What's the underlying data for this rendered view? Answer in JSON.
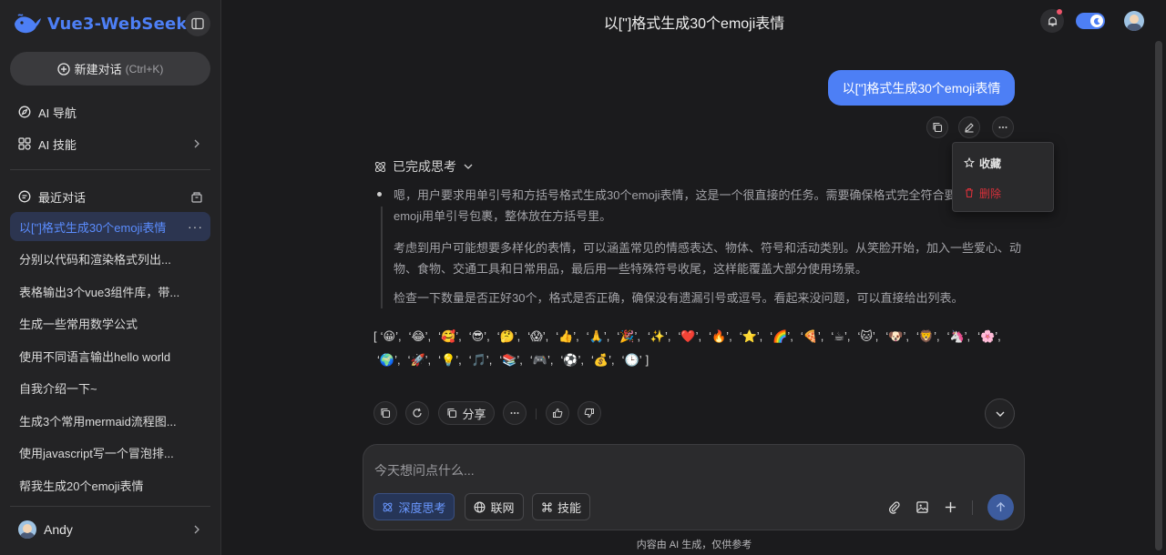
{
  "app": {
    "name": "Vue3-WebSeek",
    "accent": "#4d7ff5"
  },
  "sidebar": {
    "new_chat_label": "新建对话",
    "new_chat_shortcut": "(Ctrl+K)",
    "nav": [
      {
        "label": "AI 导航",
        "icon": "compass-icon"
      },
      {
        "label": "AI 技能",
        "icon": "grid-icon"
      }
    ],
    "recent_title": "最近对话",
    "conversations": [
      "以[\"]格式生成30个emoji表情",
      "分别以代码和渲染格式列出...",
      "表格输出3个vue3组件库，带...",
      "生成一些常用数学公式",
      "使用不同语言输出hello world",
      "自我介绍一下~",
      "生成3个常用mermaid流程图...",
      "使用javascript写一个冒泡排...",
      "帮我生成20个emoji表情"
    ],
    "active_more": "···",
    "user_name": "Andy"
  },
  "header": {
    "title": "以[\"]格式生成30个emoji表情"
  },
  "message": {
    "user_text": "以[\"]格式生成30个emoji表情",
    "menu": {
      "favorite": "收藏",
      "delete": "删除"
    },
    "thinking_label": "已完成思考",
    "thinking": [
      "嗯，用户要求用单引号和方括号格式生成30个emoji表情，这是一个很直接的任务。需要确保格式完全符合要求：每个emoji用单引号包裹，整体放在方括号里。",
      "考虑到用户可能想要多样化的表情，可以涵盖常见的情感表达、物体、符号和活动类别。从笑脸开始，加入一些爱心、动物、食物、交通工具和日常用品，最后用一些特殊符号收尾，这样能覆盖大部分使用场景。",
      "检查一下数量是否正好30个，格式是否正确，确保没有遗漏引号或逗号。看起来没问题，可以直接给出列表。"
    ],
    "open_bracket": "[",
    "close_bracket": "]",
    "emojis": [
      "😀",
      "😂",
      "🥰",
      "😎",
      "🤔",
      "😱",
      "👍",
      "🙏",
      "🎉",
      "✨",
      "❤️",
      "🔥",
      "⭐",
      "🌈",
      "🍕",
      "☕",
      "🐱",
      "🐶",
      "🦁",
      "🦄",
      "🌸",
      "🌍",
      "🚀",
      "💡",
      "🎵",
      "📚",
      "🎮",
      "⚽",
      "💰",
      "🕒"
    ],
    "share_label": "分享"
  },
  "composer": {
    "placeholder": "今天想问点什么...",
    "chips": {
      "deep_think": "深度思考",
      "web": "联网",
      "skills": "技能"
    }
  },
  "footer_note": "内容由 AI 生成，仅供参考"
}
